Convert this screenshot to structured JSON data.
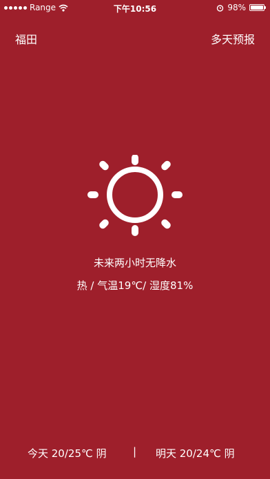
{
  "status_bar": {
    "carrier": "Range",
    "time": "下午10:56",
    "battery": "98%",
    "battery_level": 0.98
  },
  "header": {
    "city": "福田",
    "forecast_link": "多天预报"
  },
  "weather": {
    "icon": "sun-icon",
    "precipitation": "未来两小时无降水",
    "details": "热 / 气温19℃/ 湿度81%"
  },
  "footer": {
    "today": "今天  20/25℃ 阴",
    "separator": "|",
    "tomorrow": "明天  20/24℃ 阴"
  },
  "colors": {
    "background": "#9e1f2b",
    "foreground": "#ffffff"
  }
}
